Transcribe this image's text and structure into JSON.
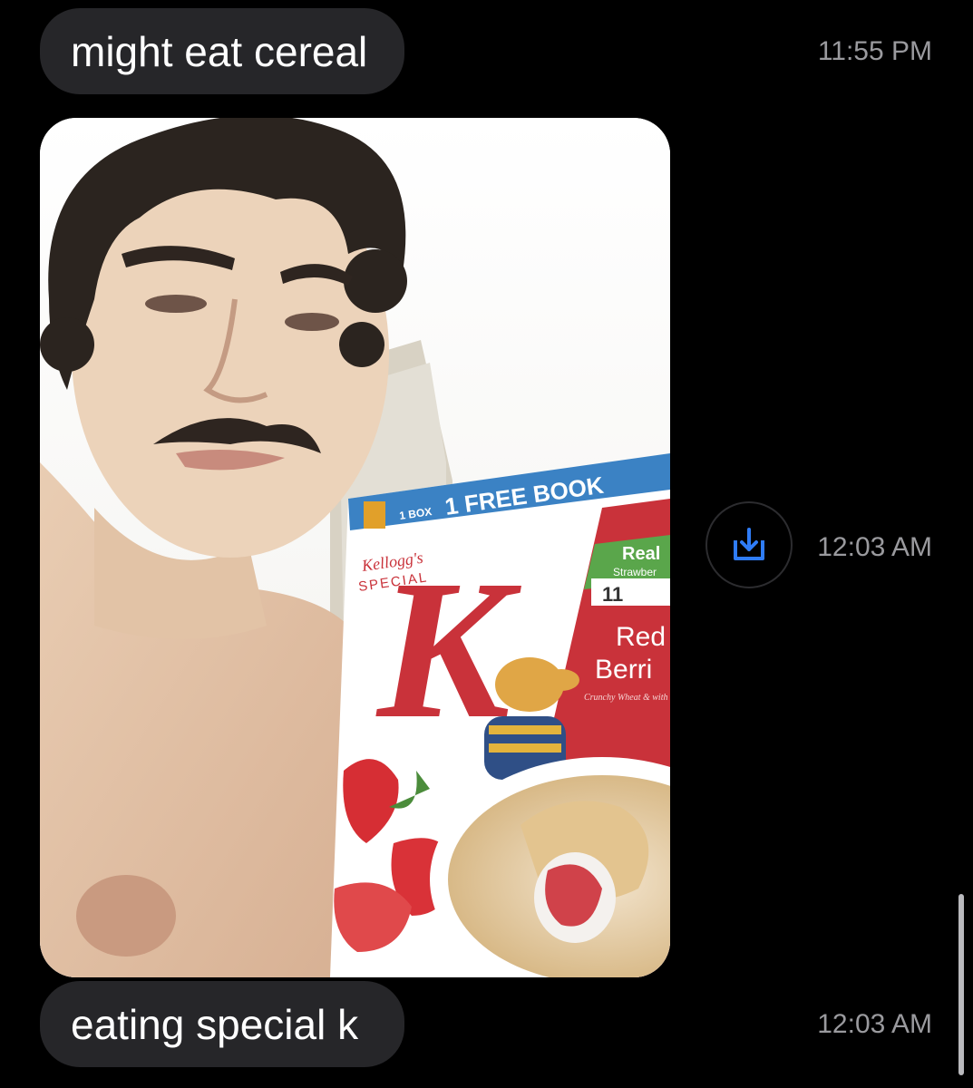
{
  "messages": [
    {
      "text": "might eat cereal",
      "time": "11:55 PM"
    },
    {
      "type": "image",
      "alt": "selfie holding cereal box",
      "time": "12:03 AM"
    },
    {
      "text": "eating special k",
      "time": "12:03 AM"
    }
  ],
  "cereal_box": {
    "promo_count": "1 BOX",
    "promo_text": "1 FREE BOOK",
    "brand": "Kellogg's",
    "product": "SPECIAL",
    "letter": "K",
    "claim_top": "Real",
    "claim_sub": "Strawber",
    "vitamins": "11",
    "flavor_line1": "Red",
    "flavor_line2": "Berri",
    "tagline": "Crunchy Wheat & with Real Str"
  },
  "icons": {
    "save": "download-tray-icon"
  },
  "colors": {
    "background": "#000000",
    "bubble": "#262629",
    "timestamp": "#9a9a9e",
    "accent": "#2f7cf6",
    "cereal_red": "#c9323a"
  }
}
